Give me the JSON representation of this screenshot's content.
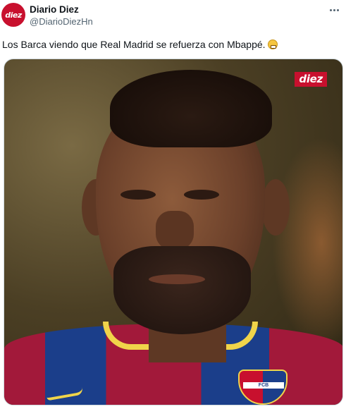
{
  "tweet": {
    "author_name": "Diario Diez",
    "author_handle": "@DiarioDiezHn",
    "avatar_text": "diez",
    "text": "Los Barca viendo que Real Madrid se refuerza con Mbappé.",
    "emoji": "grimacing-face",
    "more_icon": "more-horizontal-icon",
    "media": {
      "watermark": "diez",
      "crest_text": "FCB"
    },
    "colors": {
      "brand_red": "#c8102e",
      "text": "#0f1419",
      "muted": "#536471",
      "barca_blue": "#1b3e8a",
      "barca_red": "#a2193a",
      "collar_yellow": "#f0d44a"
    }
  }
}
